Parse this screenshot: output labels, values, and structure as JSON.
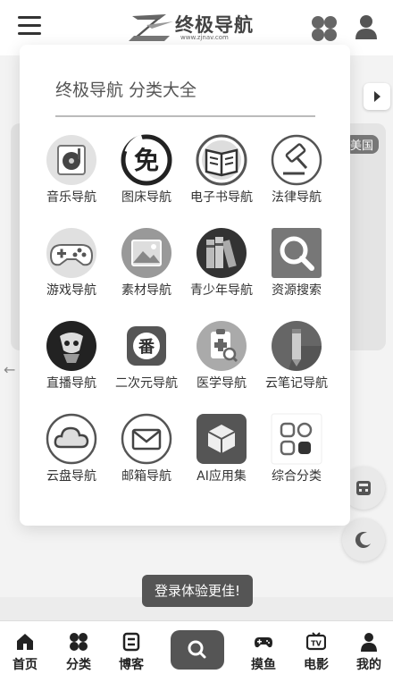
{
  "header": {
    "logo_title": "终极导航",
    "logo_url": "www.zjnav.com"
  },
  "background": {
    "tag": "美国"
  },
  "panel": {
    "title": "终极导航 分类大全",
    "items": [
      {
        "label": "音乐导航",
        "icon": "music-disc-icon"
      },
      {
        "label": "图床导航",
        "icon": "free-badge-icon"
      },
      {
        "label": "电子书导航",
        "icon": "open-book-icon"
      },
      {
        "label": "法律导航",
        "icon": "gavel-icon"
      },
      {
        "label": "游戏导航",
        "icon": "gamepad-icon"
      },
      {
        "label": "素材导航",
        "icon": "image-icon"
      },
      {
        "label": "青少年导航",
        "icon": "books-icon"
      },
      {
        "label": "资源搜索",
        "icon": "magnifier-icon"
      },
      {
        "label": "直播导航",
        "icon": "live-broadcast-icon"
      },
      {
        "label": "二次元导航",
        "icon": "anime-fan-icon"
      },
      {
        "label": "医学导航",
        "icon": "medical-clipboard-icon"
      },
      {
        "label": "云笔记导航",
        "icon": "note-pencil-icon"
      },
      {
        "label": "云盘导航",
        "icon": "cloud-icon"
      },
      {
        "label": "邮箱导航",
        "icon": "envelope-icon"
      },
      {
        "label": "AI应用集",
        "icon": "cube-icon"
      },
      {
        "label": "综合分类",
        "icon": "grid-apps-icon"
      }
    ]
  },
  "toast": "登录体验更佳!",
  "bottom_nav": [
    {
      "label": "首页",
      "icon": "home-icon"
    },
    {
      "label": "分类",
      "icon": "category-icon"
    },
    {
      "label": "博客",
      "icon": "blog-icon"
    },
    {
      "label": "",
      "icon": "search-icon"
    },
    {
      "label": "摸鱼",
      "icon": "gamepad-icon"
    },
    {
      "label": "电影",
      "icon": "tv-icon"
    },
    {
      "label": "我的",
      "icon": "user-icon"
    }
  ]
}
